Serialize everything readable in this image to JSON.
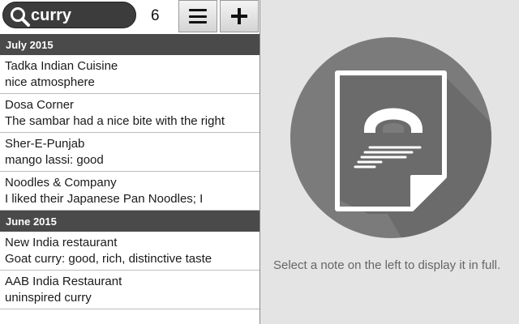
{
  "search": {
    "query": "curry",
    "result_count": "6"
  },
  "icons": {
    "search": "search-icon",
    "menu": "hamburger-menu-icon",
    "add": "plus-icon",
    "empty_note": "note-page-icon"
  },
  "colors": {
    "group_header": "#4a4a4a",
    "search_box": "#3c3c3c",
    "circle": "#7b7b7b"
  },
  "groups": [
    {
      "label": "July 2015",
      "notes": [
        {
          "title": "Tadka Indian Cuisine",
          "preview": "nice atmosphere"
        },
        {
          "title": "Dosa Corner",
          "preview": "The sambar had a nice bite with the right"
        },
        {
          "title": "Sher-E-Punjab",
          "preview": "mango lassi: good"
        },
        {
          "title": "Noodles & Company",
          "preview": "I liked their Japanese Pan Noodles; I"
        }
      ]
    },
    {
      "label": "June 2015",
      "notes": [
        {
          "title": "New India restaurant",
          "preview": "Goat curry: good, rich, distinctive taste"
        },
        {
          "title": "AAB India Restaurant",
          "preview": "uninspired curry"
        }
      ]
    }
  ],
  "detail": {
    "empty_message": "Select a note on the left to display it in full."
  }
}
